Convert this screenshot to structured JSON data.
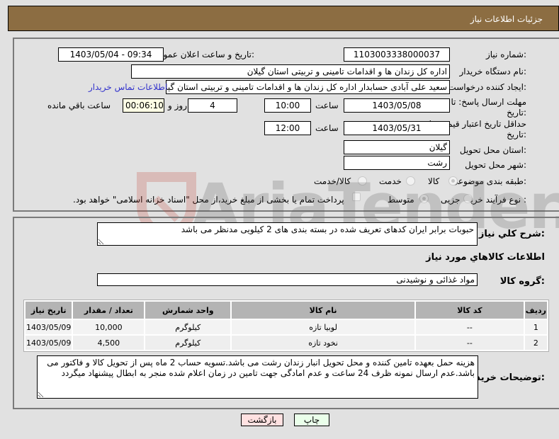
{
  "header": {
    "title": "جزئیات اطلاعات نیاز"
  },
  "form": {
    "need_number_label": "شماره نیاز:",
    "need_number": "1103003338000037",
    "announce_label": "تاریخ و ساعت اعلان عمومی:",
    "announce_value": "1403/05/04 - 09:34",
    "buyer_org_label": "نام دستگاه خریدار:",
    "buyer_org": "اداره کل زندان ها و اقدامات تامینی و تربیتی استان گیلان",
    "creator_label": "ایجاد کننده درخواست:",
    "creator": "سعید علی آبادی حسابدار اداره کل زندان ها و اقدامات تامینی و تربیتی استان گیلان",
    "contact_link": "اطلاعات تماس خریدار",
    "deadline_label": "مهلت ارسال پاسخ: تا تاریخ:",
    "deadline_date": "1403/05/08",
    "time_label": "ساعت",
    "deadline_time": "10:00",
    "days_value": "4",
    "days_label": "روز و",
    "remaining_value": "00:06:10",
    "remaining_label": "ساعت باقي مانده",
    "validity_label": "حداقل تاریخ اعتبار قیمت: تا تاریخ:",
    "validity_date": "1403/05/31",
    "validity_time": "12:00",
    "province_label": "استان محل تحویل:",
    "province": "گیلان",
    "city_label": "شهر محل تحویل:",
    "city": "رشت",
    "category_label": "طبقه بندی موضوعی:",
    "category_options": [
      {
        "label": "کالا",
        "checked": true
      },
      {
        "label": "خدمت",
        "checked": false
      },
      {
        "label": "کالا/خدمت",
        "checked": false
      }
    ],
    "process_label": "نوع فرآیند خرید :",
    "process_options": [
      {
        "label": "جزیی",
        "checked": false
      },
      {
        "label": "متوسط",
        "checked": true
      }
    ],
    "treasury_checkbox_label": "پرداخت تمام یا بخشی از مبلغ خرید،از محل \"اسناد خزانه اسلامی\" خواهد بود."
  },
  "details": {
    "summary_label": "شرح کلي نیاز:",
    "summary": "حبوبات برابر ایران کدهای تعریف شده در بسته بندی های 2 کیلویی مدنظر می باشد",
    "goods_info_title": "اطلاعات کالاهاي مورد نیاز",
    "goods_group_label": "گروه کالا:",
    "goods_group": "مواد غذائی و نوشیدنی",
    "table": {
      "headers": [
        "ردیف",
        "کد کالا",
        "نام کالا",
        "واحد شمارش",
        "تعداد / مقدار",
        "تاریخ نیاز"
      ],
      "rows": [
        [
          "1",
          "--",
          "لوبیا تازه",
          "کیلوگرم",
          "10,000",
          "1403/05/09"
        ],
        [
          "2",
          "--",
          "نخود تازه",
          "کیلوگرم",
          "4,500",
          "1403/05/09"
        ]
      ]
    },
    "buyer_notes_label": "توضیحات خریدار:",
    "buyer_notes": "هزینه حمل بعهده تامین کننده و محل تحویل انبار زندان رشت می باشد.تسویه حساب 2 ماه پس از تحویل کالا و فاکتور می باشد.عدم ارسال نمونه ظرف 24 ساعت و عدم امادگی جهت تامین در زمان اعلام شده منجر به ابطال پیشنهاد میگردد"
  },
  "buttons": {
    "print": "چاپ",
    "back": "بازگشت"
  },
  "watermark": {
    "text": "AriaTender.net"
  }
}
